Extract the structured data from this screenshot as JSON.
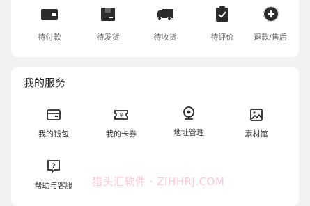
{
  "orders": {
    "items": [
      {
        "label": "待付款",
        "icon": "wallet-icon"
      },
      {
        "label": "待发货",
        "icon": "package-icon"
      },
      {
        "label": "待收货",
        "icon": "truck-icon"
      },
      {
        "label": "待评价",
        "icon": "clipboard-check-icon"
      },
      {
        "label": "退款/售后",
        "icon": "refund-icon"
      }
    ]
  },
  "services": {
    "title": "我的服务",
    "items": [
      {
        "label": "我的钱包",
        "icon": "wallet-outline-icon"
      },
      {
        "label": "我的卡券",
        "icon": "coupon-icon"
      },
      {
        "label": "地址管理",
        "icon": "location-pin-icon"
      },
      {
        "label": "素材馆",
        "icon": "image-gallery-icon"
      },
      {
        "label": "帮助与客服",
        "icon": "help-icon"
      }
    ]
  },
  "watermark": "猎头汇软件 · ZIHHRJ.COM",
  "colors": {
    "background": "#f2f2f4",
    "card": "#ffffff",
    "icon_dark": "#2b2b2b",
    "watermark": "#ff96be"
  }
}
